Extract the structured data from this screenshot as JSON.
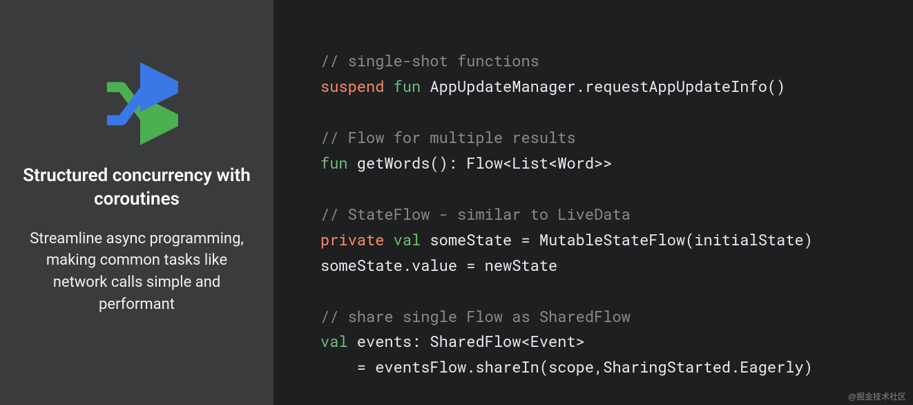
{
  "left": {
    "title": "Structured concurrency\nwith coroutines",
    "desc": "Streamline async\nprogramming,\nmaking common tasks like\nnetwork calls simple and\nperformant"
  },
  "code": {
    "c1": "// single-shot functions",
    "l2_kw1": "suspend",
    "l2_kw2": "fun",
    "l2_rest": " AppUpdateManager.requestAppUpdateInfo()",
    "c2": "// Flow for multiple results",
    "l4_kw2": "fun",
    "l4_rest": " getWords(): Flow<List<Word>>",
    "c3": "// StateFlow - similar to LiveData",
    "l6_kw1": "private",
    "l6_kw2": "val",
    "l6_rest": " someState = MutableStateFlow(initialState)",
    "l7": "someState.value = newState",
    "c4": "// share single Flow as SharedFlow",
    "l9_kw2": "val",
    "l9_rest": " events: SharedFlow<Event>",
    "l10": "    = eventsFlow.shareIn(scope,SharingStarted.Eagerly)"
  },
  "watermark": "@掘金技术社区"
}
